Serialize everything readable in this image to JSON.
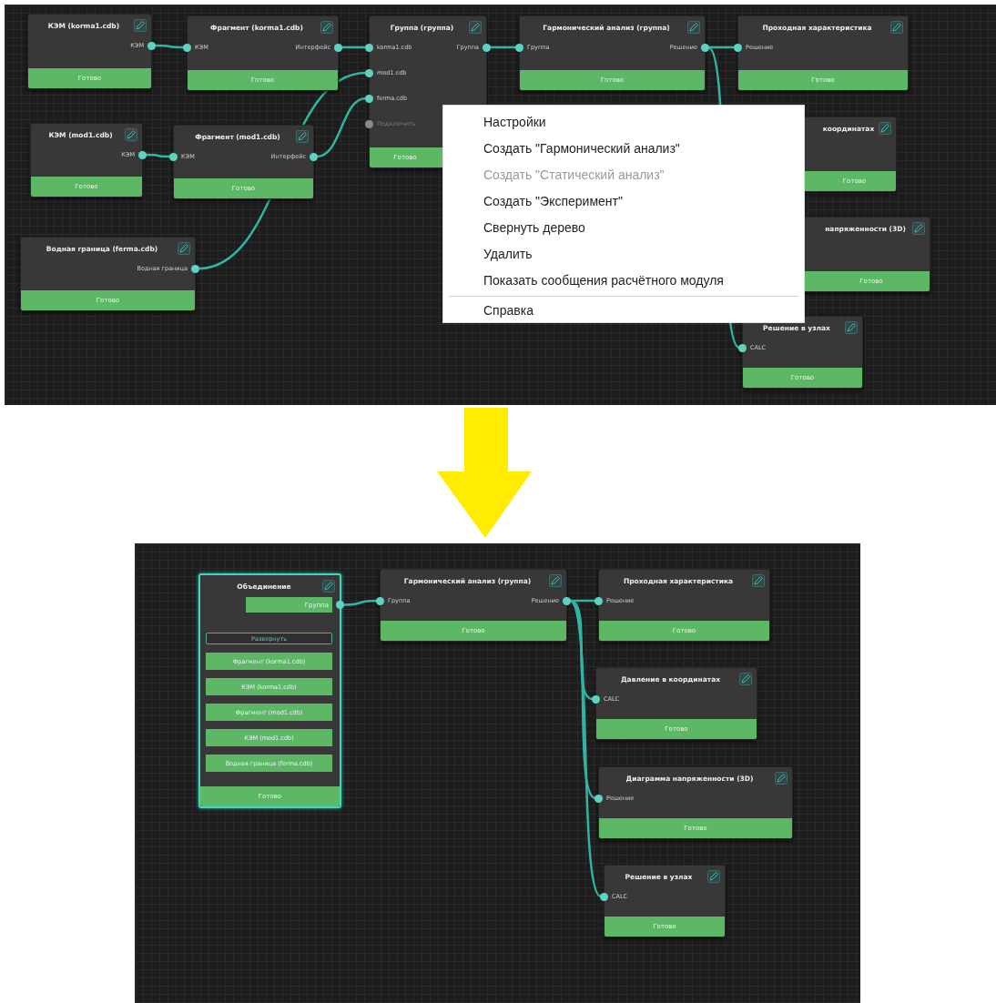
{
  "panels": [
    {
      "kind": "before",
      "nodes": [
        {
          "kind": "node",
          "title": "КЭМ (korma1.cdb)",
          "selected": false,
          "outputs": [
            {
              "label": "КЭМ"
            }
          ],
          "status": "Готово"
        },
        {
          "kind": "node",
          "title": "Фрагмент (korma1.cdb)",
          "selected": false,
          "inputs": [
            {
              "label": "КЭМ",
              "disabled": false
            }
          ],
          "outputs": [
            {
              "label": "Интерфейс"
            }
          ],
          "status": "Готово"
        },
        {
          "kind": "node",
          "title": "Группа (группа)",
          "selected": false,
          "inputs": [
            {
              "label": "korma1.cdb",
              "disabled": false
            },
            {
              "label": "mod1.cdb",
              "disabled": false
            },
            {
              "label": "ferma.cdb",
              "disabled": false
            },
            {
              "label": "Подключить",
              "disabled": true
            }
          ],
          "outputs": [
            {
              "label": "Группа"
            }
          ],
          "status": "Готово"
        },
        {
          "kind": "node",
          "title": "Гармонический анализ (группа)",
          "selected": false,
          "inputs": [
            {
              "label": "Группа",
              "disabled": false
            }
          ],
          "outputs": [
            {
              "label": "Решение"
            }
          ],
          "status": "Готово"
        },
        {
          "kind": "node",
          "title": "Проходная характеристика",
          "selected": false,
          "inputs": [
            {
              "label": "Решение",
              "disabled": false
            }
          ],
          "status": "Готово"
        },
        {
          "kind": "node",
          "title": "координатах",
          "selected": false,
          "status": "Готово"
        },
        {
          "kind": "node",
          "title": "напряженности (3D)",
          "selected": false,
          "status": "Готово"
        },
        {
          "kind": "node",
          "title": "Решение в узлах",
          "selected": false,
          "inputs": [
            {
              "label": "CALC",
              "disabled": false
            }
          ],
          "status": "Готово"
        },
        {
          "kind": "node",
          "title": "КЭМ (mod1.cdb)",
          "selected": false,
          "outputs": [
            {
              "label": "КЭМ"
            }
          ],
          "status": "Готово"
        },
        {
          "kind": "node",
          "title": "Фрагмент (mod1.cdb)",
          "selected": false,
          "inputs": [
            {
              "label": "КЭМ",
              "disabled": false
            }
          ],
          "outputs": [
            {
              "label": "Интерфейс"
            }
          ],
          "status": "Готово"
        },
        {
          "kind": "node",
          "title": "Водная граница (ferma.cdb)",
          "selected": false,
          "outputs": [
            {
              "label": "Водная граница"
            }
          ],
          "status": "Готово"
        }
      ],
      "context_menu": {
        "items": [
          {
            "kind": "item",
            "label": "Настройки",
            "disabled": false
          },
          {
            "kind": "item",
            "label": "Создать \"Гармонический анализ\"",
            "disabled": false
          },
          {
            "kind": "item",
            "label": "Создать \"Статический анализ\"",
            "disabled": true
          },
          {
            "kind": "item",
            "label": "Создать \"Эксперимент\"",
            "disabled": false
          },
          {
            "kind": "item",
            "label": "Свернуть дерево",
            "disabled": false
          },
          {
            "kind": "item",
            "label": "Удалить",
            "disabled": false
          },
          {
            "kind": "item",
            "label": "Показать сообщения расчётного модуля",
            "disabled": false
          },
          {
            "kind": "separator"
          },
          {
            "kind": "item",
            "label": "Справка",
            "disabled": false
          }
        ]
      }
    },
    {
      "kind": "after",
      "nodes": [
        {
          "kind": "group",
          "title": "Объединение",
          "selected": true,
          "output": "Группа",
          "toggle": "Развернуть",
          "members": [
            "Фрагмент (korma1.cdb)",
            "КЭМ (korma1.cdb)",
            "Фрагмент (mod1.cdb)",
            "КЭМ (mod1.cdb)",
            "Водная граница (ferma.cdb)"
          ],
          "status": "Готово"
        },
        {
          "kind": "node",
          "title": "Гармонический анализ (группа)",
          "selected": false,
          "inputs": [
            {
              "label": "Группа",
              "disabled": false
            }
          ],
          "outputs": [
            {
              "label": "Решение"
            }
          ],
          "status": "Готово"
        },
        {
          "kind": "node",
          "title": "Проходная характеристика",
          "selected": false,
          "inputs": [
            {
              "label": "Решение",
              "disabled": false
            }
          ],
          "status": "Готово"
        },
        {
          "kind": "node",
          "title": "Давление в координатах",
          "selected": false,
          "inputs": [
            {
              "label": "CALC",
              "disabled": false
            }
          ],
          "status": "Готово"
        },
        {
          "kind": "node",
          "title": "Диаграмма напряженности (3D)",
          "selected": false,
          "inputs": [
            {
              "label": "Решение",
              "disabled": false
            }
          ],
          "status": "Готово"
        },
        {
          "kind": "node",
          "title": "Решение в узлах",
          "selected": false,
          "inputs": [
            {
              "label": "CALC",
              "disabled": false
            }
          ],
          "status": "Готово"
        }
      ]
    }
  ]
}
